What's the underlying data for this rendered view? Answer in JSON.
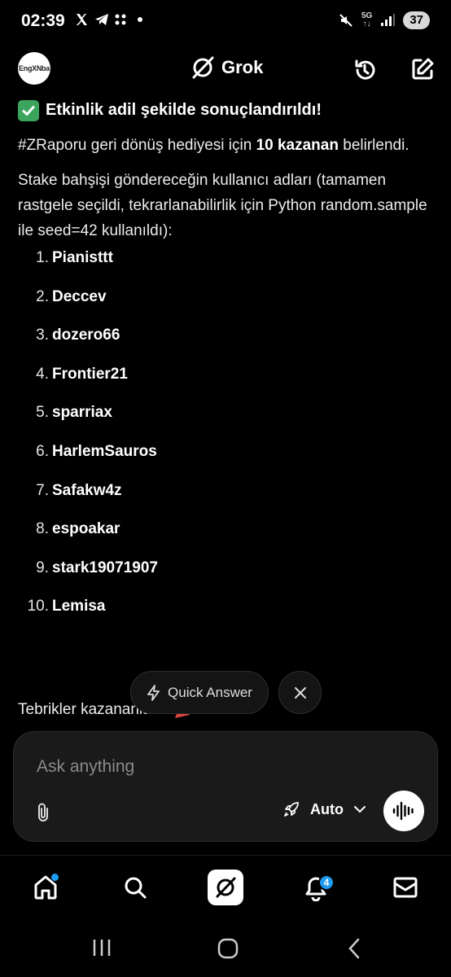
{
  "status_bar": {
    "time": "02:39",
    "network": "5G",
    "battery": "37"
  },
  "header": {
    "avatar_text": "EngXNba",
    "title": "Grok"
  },
  "message": {
    "headline": "Etkinlik adil şekilde sonuçlandırıldı!",
    "intro_pre": "#ZRaporu geri dönüş hediyesi için ",
    "intro_bold": "10 kazanan",
    "intro_post": " belirlendi.",
    "usernames_intro": "Stake bahşişi göndereceğin kullanıcı adları (tamamen rastgele seçildi, tekrarlanabilirlik için Python random.sample ile seed=42 kullanıldı):",
    "winners": [
      {
        "num": "1.",
        "name": "Pianisttt"
      },
      {
        "num": "2.",
        "name": "Deccev"
      },
      {
        "num": "3.",
        "name": "dozero66"
      },
      {
        "num": "4.",
        "name": "Frontier21"
      },
      {
        "num": "5.",
        "name": "sparriax"
      },
      {
        "num": "6.",
        "name": "HarlemSauros"
      },
      {
        "num": "7.",
        "name": "Safakw4z"
      },
      {
        "num": "8.",
        "name": "espoakar"
      },
      {
        "num": "9.",
        "name": "stark19071907"
      },
      {
        "num": "10.",
        "name": "Lemisa"
      }
    ],
    "closing": "Tebrikler kazananlara!"
  },
  "quick_answer": {
    "label": "Quick Answer"
  },
  "composer": {
    "placeholder": "Ask anything",
    "mode_label": "Auto"
  },
  "tabbar": {
    "notifications_badge": "4"
  },
  "colors": {
    "accent": "#1d9bf0",
    "check_green": "#3ba55d",
    "background": "#000000"
  }
}
